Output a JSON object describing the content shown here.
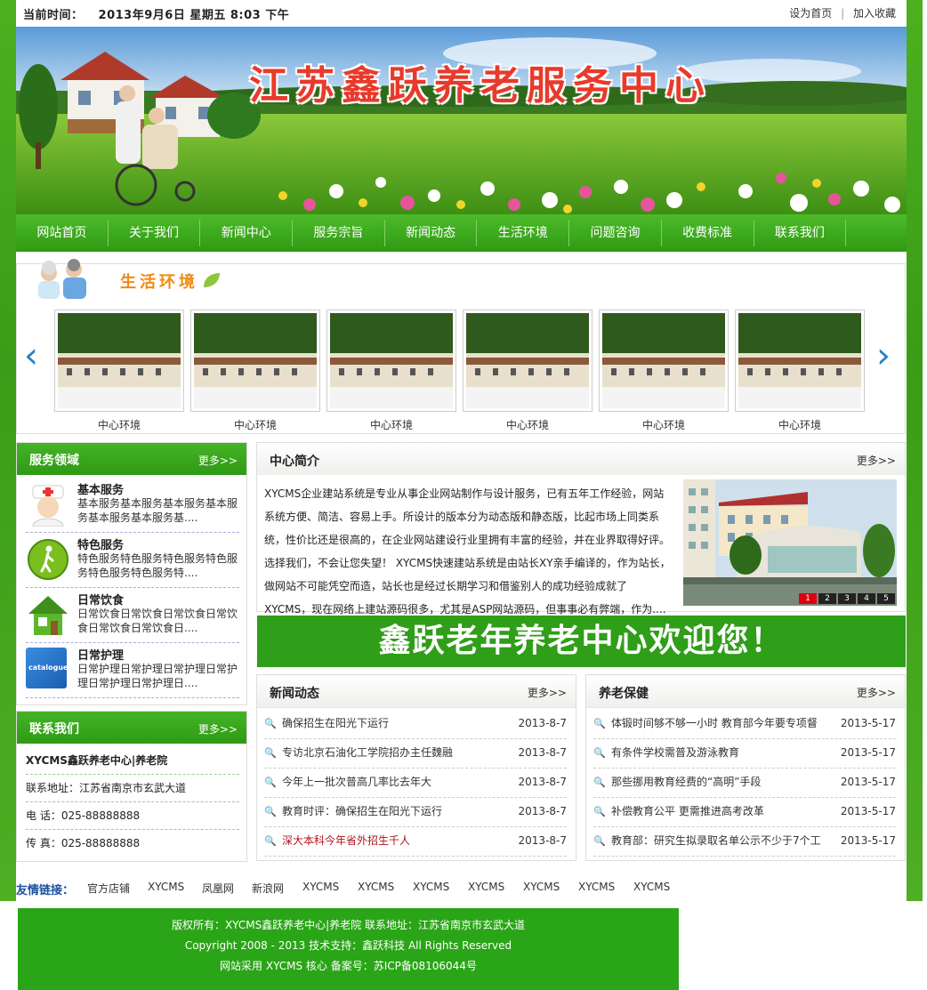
{
  "topbar": {
    "time_label": "当前时间：",
    "time_value": "2013年9月6日  星期五  8:03 下午",
    "set_home": "设为首页",
    "add_fav": "加入收藏"
  },
  "banner": {
    "title": "江苏鑫跃养老服务中心"
  },
  "nav": [
    "网站首页",
    "关于我们",
    "新闻中心",
    "服务宗旨",
    "新闻动态",
    "生活环境",
    "问题咨询",
    "收费标准",
    "联系我们"
  ],
  "gallery": {
    "title": "生活环境",
    "captions": [
      "中心环境",
      "中心环境",
      "中心环境",
      "中心环境",
      "中心环境",
      "中心环境"
    ]
  },
  "services": {
    "title": "服务领域",
    "more": "更多>>",
    "items": [
      {
        "name": "基本服务",
        "desc": "基本服务基本服务基本服务基本服务基本服务基本服务基....",
        "icon": "nurse-icon"
      },
      {
        "name": "特色服务",
        "desc": "特色服务特色服务特色服务特色服务特色服务特色服务特....",
        "icon": "walk-icon"
      },
      {
        "name": "日常饮食",
        "desc": "日常饮食日常饮食日常饮食日常饮食日常饮食日常饮食日....",
        "icon": "house-icon"
      },
      {
        "name": "日常护理",
        "desc": "日常护理日常护理日常护理日常护理日常护理日常护理日....",
        "icon": "catalogue-icon"
      }
    ],
    "catalogue_text": "catalogue"
  },
  "contact": {
    "title": "联系我们",
    "more": "更多>>",
    "name": "XYCMS鑫跃养老中心|养老院",
    "address": "联系地址：江苏省南京市玄武大道",
    "phone": "电 话：025-88888888",
    "fax": "传 真：025-88888888"
  },
  "intro": {
    "title": "中心简介",
    "more": "更多>>",
    "text": "XYCMS企业建站系统是专业从事企业网站制作与设计服务，已有五年工作经验，网站系统方便、简洁、容易上手。所设计的版本分为动态版和静态版，比起市场上同类系统，性价比还是很高的，在企业网站建设行业里拥有丰富的经验，并在业界取得好评。选择我们，不会让您失望！ XYCMS快速建站系统是由站长XY亲手编译的，作为站长，做网站不可能凭空而造，站长也是经过长期学习和借鉴别人的成功经验成就了XYCMS，现在网络上建站源码很多，尤其是ASP网站源码，但事事必有弊端，作为....",
    "slides": [
      "1",
      "2",
      "3",
      "4",
      "5"
    ]
  },
  "welcome": "鑫跃老年养老中心欢迎您！",
  "news": {
    "title": "新闻动态",
    "more": "更多>>",
    "items": [
      {
        "title": "确保招生在阳光下运行",
        "date": "2013-8-7"
      },
      {
        "title": "专访北京石油化工学院招办主任魏融",
        "date": "2013-8-7"
      },
      {
        "title": "今年上一批次普高几率比去年大",
        "date": "2013-8-7"
      },
      {
        "title": "教育时评：确保招生在阳光下运行",
        "date": "2013-8-7"
      },
      {
        "title": "深大本科今年省外招生千人",
        "date": "2013-8-7"
      }
    ]
  },
  "care": {
    "title": "养老保健",
    "more": "更多>>",
    "items": [
      {
        "title": "体锻时间够不够一小时 教育部今年要专项督",
        "date": "2013-5-17"
      },
      {
        "title": "有条件学校需普及游泳教育",
        "date": "2013-5-17"
      },
      {
        "title": "那些挪用教育经费的“高明”手段",
        "date": "2013-5-17"
      },
      {
        "title": "补偿教育公平 更需推进高考改革",
        "date": "2013-5-17"
      },
      {
        "title": "教育部：研究生拟录取名单公示不少于7个工",
        "date": "2013-5-17"
      }
    ]
  },
  "friends": {
    "label": "友情链接：",
    "links": [
      "官方店铺",
      "XYCMS",
      "凤凰网",
      "新浪网",
      "XYCMS",
      "XYCMS",
      "XYCMS",
      "XYCMS",
      "XYCMS",
      "XYCMS",
      "XYCMS"
    ]
  },
  "footer": {
    "line1": "版权所有：XYCMS鑫跃养老中心|养老院  联系地址：江苏省南京市玄武大道",
    "line2": "Copyright 2008 - 2013  技术支持：鑫跃科技 All Rights Reserved",
    "line3": "网站采用 XYCMS 核心 备案号：苏ICP备08106044号"
  },
  "colors": {
    "brand_green": "#2f9e18",
    "title_red": "#e83a2b",
    "gallery_orange": "#f08a10",
    "link_blue": "#1c4fa0",
    "news_red": "#b0131a"
  }
}
